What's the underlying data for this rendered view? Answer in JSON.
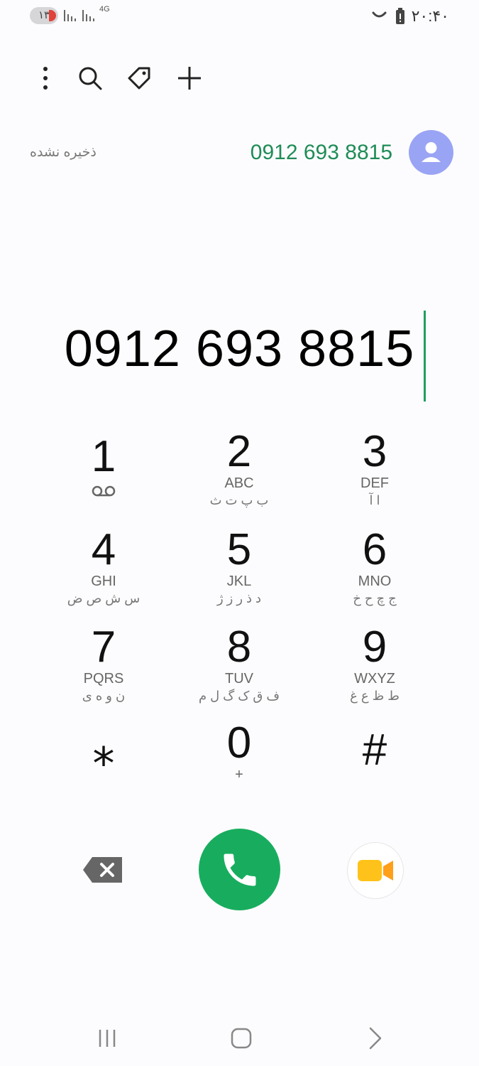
{
  "status_bar": {
    "notification_count": "۱۳",
    "network_type": "4G",
    "time": "۲۰:۴۰",
    "icons": [
      "signal-icon",
      "signal-icon",
      "moon-icon",
      "battery-icon"
    ]
  },
  "toolbar": {
    "icons": [
      "more-options-icon",
      "search-icon",
      "tag-icon",
      "add-icon"
    ]
  },
  "suggestion": {
    "status": "ذخیره نشده",
    "number": "0912 693 8815",
    "avatar_icon": "person-icon"
  },
  "dialed_number": "0912 693 8815",
  "keypad": [
    {
      "digit": "1",
      "latin": "",
      "persian": "",
      "icon": "voicemail-icon"
    },
    {
      "digit": "2",
      "latin": "ABC",
      "persian": "ب پ ت ث"
    },
    {
      "digit": "3",
      "latin": "DEF",
      "persian": "ا آ"
    },
    {
      "digit": "4",
      "latin": "GHI",
      "persian": "س ش ص ض"
    },
    {
      "digit": "5",
      "latin": "JKL",
      "persian": "د ذ ر ز ژ"
    },
    {
      "digit": "6",
      "latin": "MNO",
      "persian": "ج چ ح خ"
    },
    {
      "digit": "7",
      "latin": "PQRS",
      "persian": "ن و ه ی"
    },
    {
      "digit": "8",
      "latin": "TUV",
      "persian": "ف ق ک گ ل م"
    },
    {
      "digit": "9",
      "latin": "WXYZ",
      "persian": "ط ظ ع غ"
    },
    {
      "digit": "⁎",
      "latin": "",
      "persian": ""
    },
    {
      "digit": "0",
      "latin": "+",
      "persian": ""
    },
    {
      "digit": "#",
      "latin": "",
      "persian": ""
    }
  ],
  "actions": {
    "backspace_icon": "backspace-icon",
    "call_icon": "phone-icon",
    "video_icon": "video-call-icon",
    "colors": {
      "call": "#18ad5e",
      "video": "#ffc21a",
      "accent_text": "#1f8c57"
    }
  },
  "nav_bar": {
    "icons": [
      "recent-apps-icon",
      "home-icon",
      "back-icon"
    ]
  }
}
